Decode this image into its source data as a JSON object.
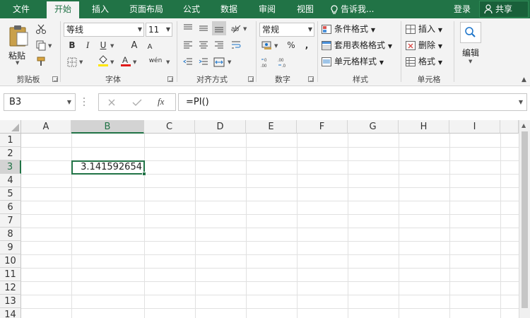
{
  "menu": {
    "tabs": [
      "文件",
      "开始",
      "插入",
      "页面布局",
      "公式",
      "数据",
      "审阅",
      "视图"
    ],
    "active_tab": "开始",
    "tell_me": "告诉我...",
    "login": "登录",
    "share": "共享"
  },
  "ribbon": {
    "clipboard": {
      "paste": "粘贴",
      "label": "剪贴板"
    },
    "font": {
      "name": "等线",
      "size": "11",
      "bold": "B",
      "italic": "I",
      "underline": "U",
      "grow": "A",
      "shrink": "A",
      "label": "字体",
      "phonetic": "wén"
    },
    "alignment": {
      "label": "对齐方式"
    },
    "number": {
      "format": "常规",
      "label": "数字",
      "percent": "%",
      "comma": ","
    },
    "styles": {
      "conditional": "条件格式",
      "table": "套用表格格式",
      "cell": "单元格样式",
      "label": "样式"
    },
    "cells": {
      "insert": "插入",
      "delete": "删除",
      "format": "格式",
      "label": "单元格"
    },
    "editing": {
      "label": "编辑"
    }
  },
  "formula_bar": {
    "name_box": "B3",
    "fx": "fx",
    "formula": "=PI()"
  },
  "sheet": {
    "columns": [
      "A",
      "B",
      "C",
      "D",
      "E",
      "F",
      "G",
      "H",
      "I"
    ],
    "rows": [
      "1",
      "2",
      "3",
      "4",
      "5",
      "6",
      "7",
      "8",
      "9",
      "10",
      "11",
      "12",
      "13",
      "14"
    ],
    "selected_column": "B",
    "selected_row": "3",
    "cell_b3_value": "3.141592654"
  },
  "colors": {
    "excel_green": "#217346",
    "ribbon_bg": "#f3f3f3"
  }
}
